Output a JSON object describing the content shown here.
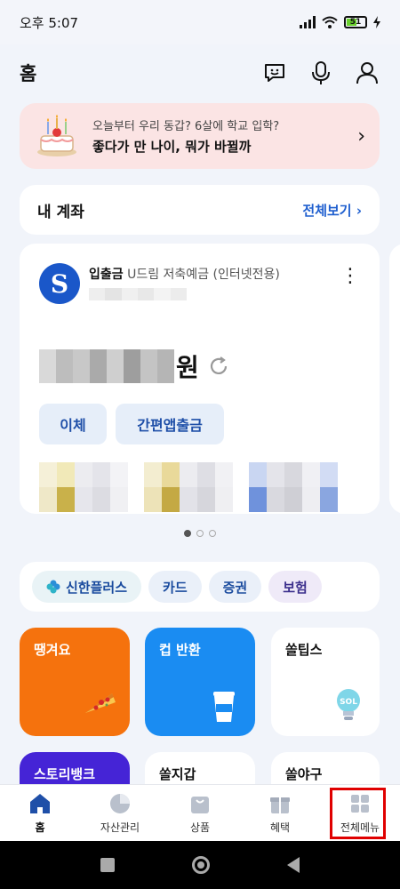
{
  "status_bar": {
    "time": "오후 5:07",
    "battery": "51"
  },
  "header": {
    "title": "홈"
  },
  "banner": {
    "line1": "오늘부터 우리 동갑? 6살에 학교 입학?",
    "line2": "좋다가 만 나이, 뭐가 바뀔까",
    "arrow": "›"
  },
  "my_account": {
    "title": "내 계좌",
    "view_all": "전체보기 ›"
  },
  "account_card": {
    "type": "입출금",
    "product": "U드림 저축예금 (인터넷전용)",
    "currency_unit": "원",
    "transfer_label": "이체",
    "atm_label": "간편앱출금",
    "kebab": "⋮"
  },
  "chips": [
    {
      "label": "신한플러스"
    },
    {
      "label": "카드"
    },
    {
      "label": "증권"
    },
    {
      "label": "보험"
    }
  ],
  "tiles": [
    {
      "label": "땡겨요"
    },
    {
      "label": "컵 반환"
    },
    {
      "label": "쏠팁스"
    },
    {
      "label": "스토리뱅크"
    },
    {
      "label": "쏠지갑"
    },
    {
      "label": "쏠야구"
    }
  ],
  "bottom_nav": [
    {
      "label": "홈",
      "icon": "home-icon"
    },
    {
      "label": "자산관리",
      "icon": "pie-chart-icon"
    },
    {
      "label": "상품",
      "icon": "shopping-bag-icon"
    },
    {
      "label": "혜택",
      "icon": "gift-icon"
    },
    {
      "label": "전체메뉴",
      "icon": "grid-icon"
    }
  ],
  "colors": {
    "accent_blue": "#1f5fcf",
    "banner_bg": "#fbe4e4",
    "orange_tile": "#f5720d",
    "blue_tile": "#1a8cf2",
    "purple_tile": "#4524d6",
    "highlight": "#e00000"
  },
  "pager": {
    "count": 3,
    "active": 0
  }
}
